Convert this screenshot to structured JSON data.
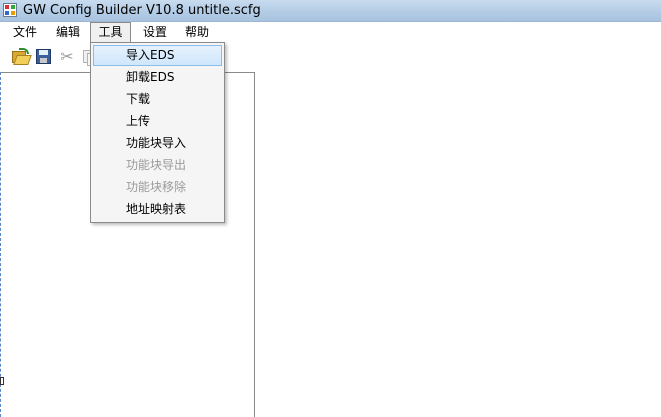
{
  "window": {
    "title": "GW Config Builder V10.8   untitle.scfg"
  },
  "menubar": {
    "items": [
      {
        "label": "文件"
      },
      {
        "label": "编辑"
      },
      {
        "label": "工具"
      },
      {
        "label": "设置"
      },
      {
        "label": "帮助"
      }
    ],
    "active_index": 2
  },
  "toolbar": {
    "buttons": [
      {
        "icon": "open-folder-icon",
        "enabled": true
      },
      {
        "icon": "save-icon",
        "enabled": true
      },
      {
        "icon": "cut-icon",
        "enabled": false
      },
      {
        "icon": "copy-icon",
        "enabled": false
      }
    ]
  },
  "tools_menu": {
    "items": [
      {
        "label": "导入EDS",
        "enabled": true,
        "highlighted": true
      },
      {
        "label": "卸载EDS",
        "enabled": true
      },
      {
        "label": "下载",
        "enabled": true
      },
      {
        "label": "上传",
        "enabled": true
      },
      {
        "label": "功能块导入",
        "enabled": true
      },
      {
        "label": "功能块导出",
        "enabled": false
      },
      {
        "label": "功能块移除",
        "enabled": false
      },
      {
        "label": "地址映射表",
        "enabled": true
      }
    ]
  },
  "colors": {
    "title_bar": "#b5cde6",
    "menu_highlight": "#cfe6fb",
    "disabled_text": "#9a9a9a"
  }
}
